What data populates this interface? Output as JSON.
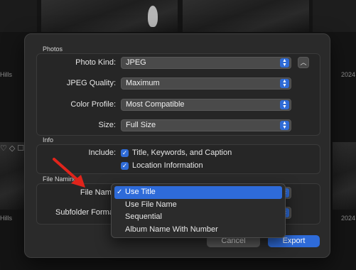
{
  "background": {
    "side_labels": {
      "left_top": "Hills",
      "left_bottom": "Hills",
      "right_top": "2024",
      "right_bottom": "2024"
    }
  },
  "dialog": {
    "photos_section": {
      "title": "Photos",
      "photo_kind": {
        "label": "Photo Kind:",
        "value": "JPEG"
      },
      "jpeg_quality": {
        "label": "JPEG Quality:",
        "value": "Maximum"
      },
      "color_profile": {
        "label": "Color Profile:",
        "value": "Most Compatible"
      },
      "size": {
        "label": "Size:",
        "value": "Full Size"
      },
      "expand_button_icon": "chevron-up"
    },
    "info_section": {
      "title": "Info",
      "include_label": "Include:",
      "options": [
        {
          "label": "Title, Keywords, and Caption",
          "checked": true
        },
        {
          "label": "Location Information",
          "checked": true
        }
      ]
    },
    "file_naming_section": {
      "title": "File Naming",
      "file_name_label": "File Name",
      "subfolder_format_label": "Subfolder Format"
    },
    "buttons": {
      "cancel": "Cancel",
      "export": "Export"
    }
  },
  "file_name_menu": {
    "items": [
      {
        "label": "Use Title",
        "selected": true
      },
      {
        "label": "Use File Name",
        "selected": false
      },
      {
        "label": "Sequential",
        "selected": false
      },
      {
        "label": "Album Name With Number",
        "selected": false
      }
    ],
    "checkmark": "✓"
  },
  "colors": {
    "accent": "#2e6bd9",
    "annotation_arrow": "#e0241b"
  }
}
